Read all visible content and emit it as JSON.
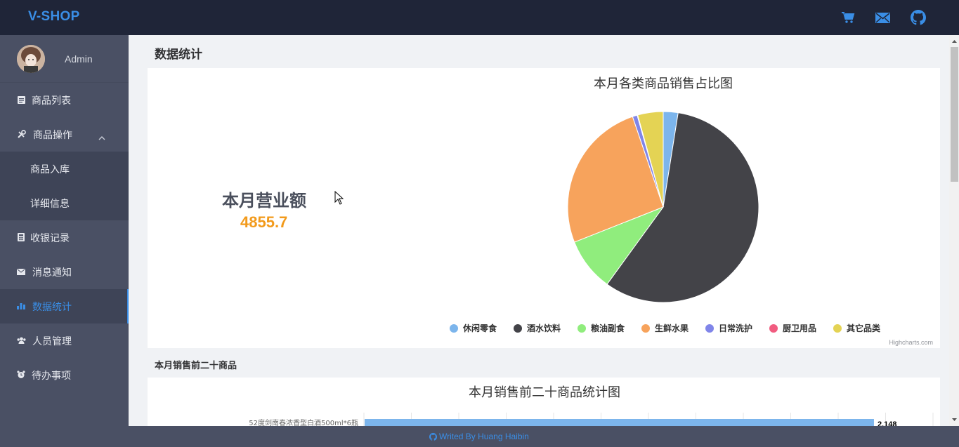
{
  "app": {
    "brand": "V-SHOP"
  },
  "topbar": {
    "icons": [
      "cart-icon",
      "mail-icon",
      "github-icon"
    ]
  },
  "user": {
    "name": "Admin"
  },
  "sidebar": {
    "items": [
      {
        "label": "商品列表",
        "icon": "list-icon"
      },
      {
        "label": "商品操作",
        "icon": "tools-icon",
        "expanded": true
      },
      {
        "label": "商品入库",
        "sub": true
      },
      {
        "label": "详细信息",
        "sub": true
      },
      {
        "label": "收银记录",
        "icon": "calculator-icon"
      },
      {
        "label": "消息通知",
        "icon": "mail-icon"
      },
      {
        "label": "数据统计",
        "icon": "bar-chart-icon",
        "active": true
      },
      {
        "label": "人员管理",
        "icon": "users-icon"
      },
      {
        "label": "待办事项",
        "icon": "alarm-icon"
      }
    ]
  },
  "main": {
    "page_title": "数据统计",
    "sales_label": "本月营业额",
    "sales_value": "4855.7",
    "top20_section_label": "本月销售前二十商品",
    "credits": "Highcharts.com"
  },
  "colors": {
    "topbar": "#1f2538",
    "sidebar": "#4a5064",
    "accent": "#3a8ee6",
    "sales_value": "#f29a1b"
  },
  "chart_data": [
    {
      "type": "pie",
      "title": "本月各类商品销售占比图",
      "categories": [
        "休闲零食",
        "酒水饮料",
        "粮油副食",
        "生鲜水果",
        "日常洗护",
        "厨卫用品",
        "其它品类"
      ],
      "values": [
        2.5,
        57.5,
        9.0,
        25.8,
        0.8,
        0.1,
        4.3
      ],
      "colors": [
        "#7cb5ec",
        "#434348",
        "#90ed7d",
        "#f7a35c",
        "#8085e9",
        "#f15c80",
        "#e4d354"
      ],
      "legend": "bottom"
    },
    {
      "type": "bar",
      "title": "本月销售前二十商品统计图",
      "categories": [
        "52度剑南春浓香型白酒500ml*6瓶"
      ],
      "values": [
        2148
      ],
      "value_labels": [
        "2,148"
      ]
    }
  ],
  "footer": {
    "text": "Writed By Huang Haibin"
  }
}
